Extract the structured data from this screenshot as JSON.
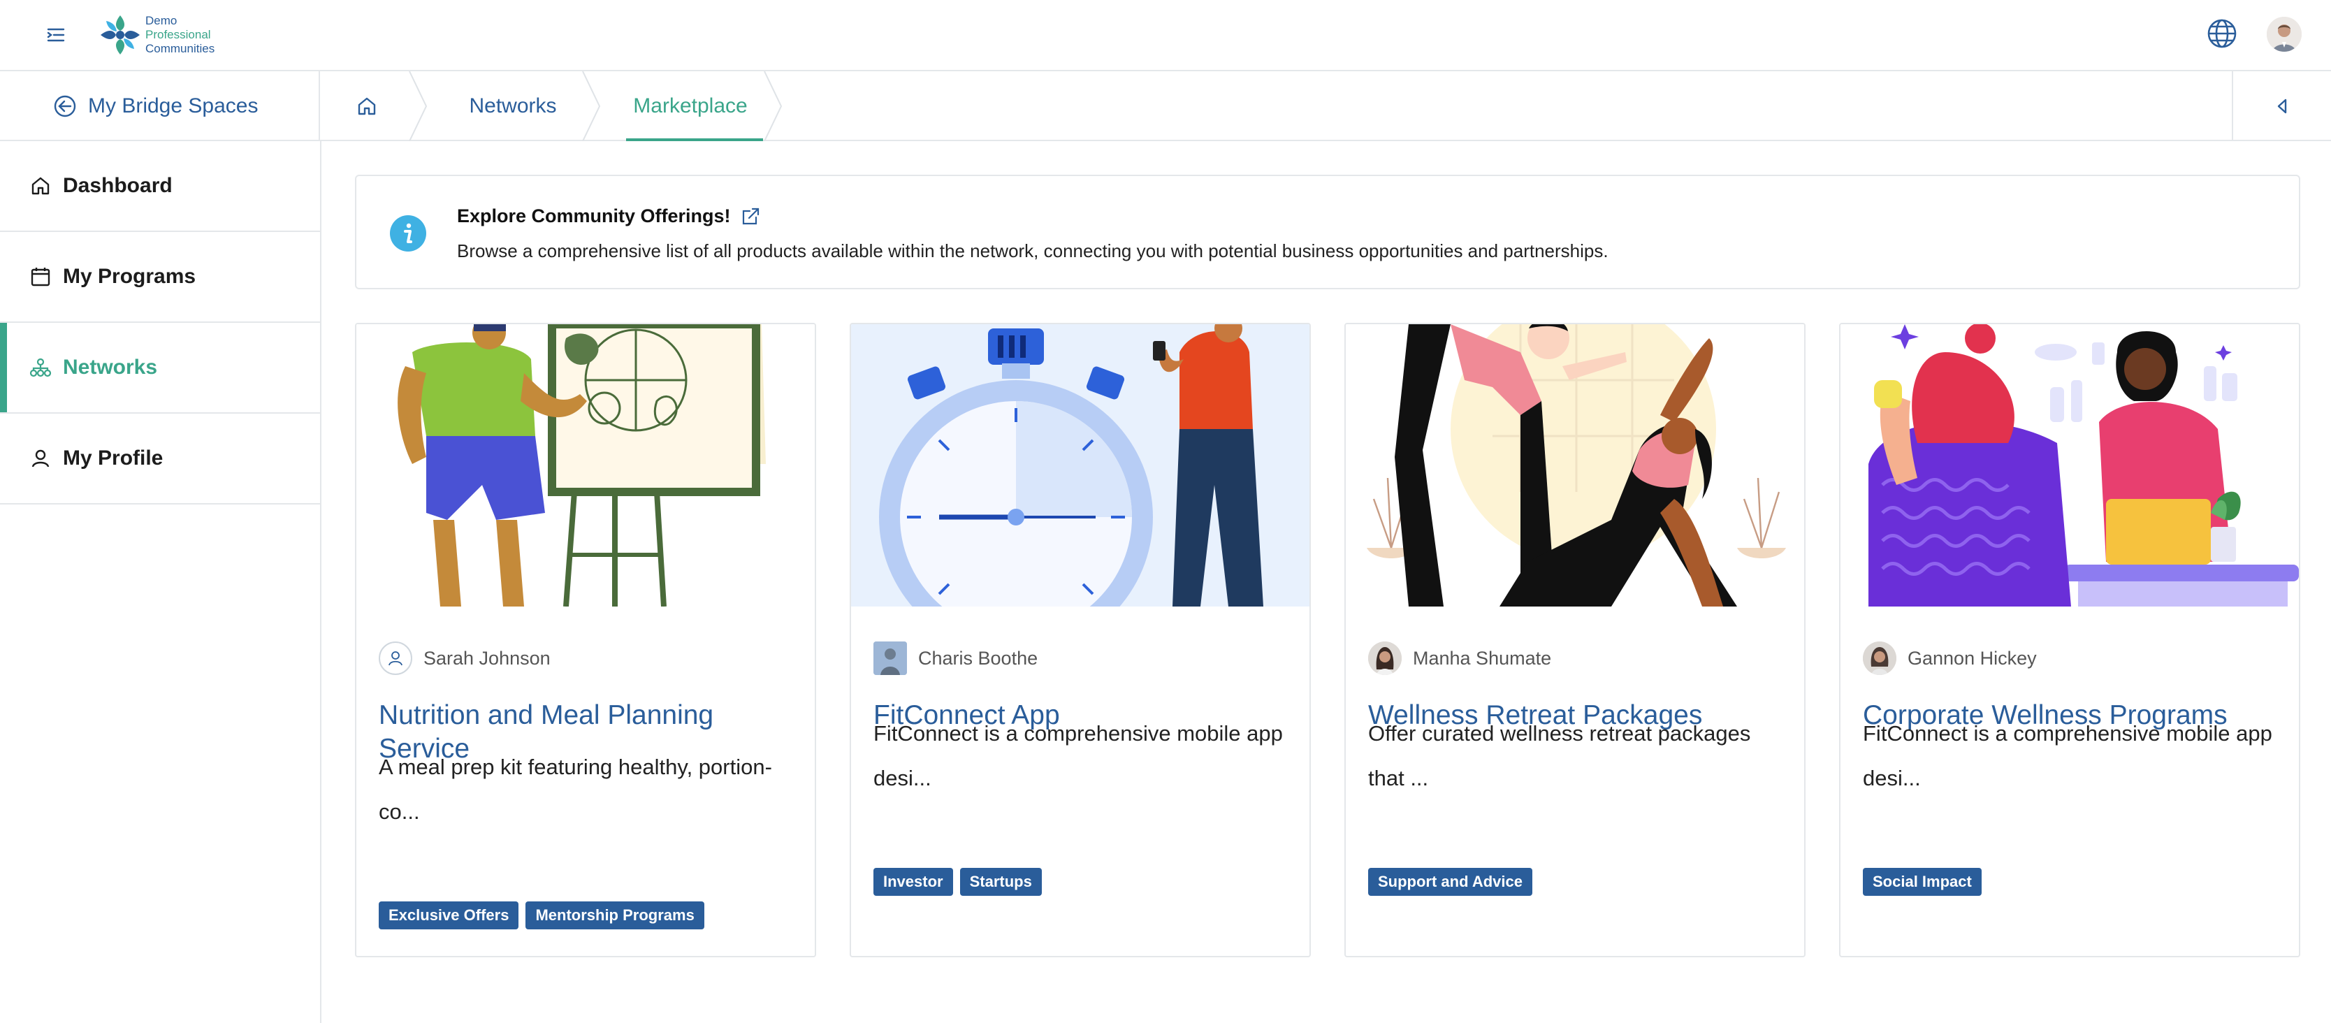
{
  "header": {
    "logo_line1": "Demo",
    "logo_line2": "Professional",
    "logo_line3": "Communities"
  },
  "subbar": {
    "back_label": "My Bridge Spaces",
    "crumb_networks": "Networks",
    "crumb_marketplace": "Marketplace"
  },
  "sidebar": {
    "items": [
      {
        "label": "Dashboard"
      },
      {
        "label": "My Programs"
      },
      {
        "label": "Networks"
      },
      {
        "label": "My Profile"
      }
    ]
  },
  "banner": {
    "title": "Explore Community Offerings!",
    "description": "Browse a comprehensive list of all products available within the network, connecting you with potential business opportunities and partnerships."
  },
  "cards": [
    {
      "author": "Sarah Johnson",
      "title": "Nutrition and Meal Planning Service",
      "description": "A meal prep kit featuring healthy, portion-co...",
      "tags": [
        "Exclusive Offers",
        "Mentorship Programs"
      ]
    },
    {
      "author": "Charis Boothe",
      "title": "FitConnect App",
      "description": "FitConnect is a comprehensive mobile app desi...",
      "tags": [
        "Investor",
        "Startups"
      ]
    },
    {
      "author": "Manha Shumate",
      "title": "Wellness Retreat Packages",
      "description": "Offer curated wellness retreat packages that ...",
      "tags": [
        "Support and Advice"
      ]
    },
    {
      "author": "Gannon Hickey",
      "title": "Corporate Wellness Programs",
      "description": "FitConnect is a comprehensive mobile app desi...",
      "tags": [
        "Social Impact"
      ]
    }
  ],
  "colors": {
    "primary_blue": "#2a5d9a",
    "accent_green": "#3aa58a",
    "info_blue": "#3fb1e3",
    "border": "#e4e7ea"
  },
  "icons": {
    "menu": "menu-toggle-icon",
    "globe": "globe-icon",
    "back": "arrow-left-circle-icon",
    "home": "home-icon",
    "collapse": "caret-left-icon",
    "dashboard": "home-icon",
    "programs": "calendar-icon",
    "networks": "network-icon",
    "profile": "user-icon",
    "info": "info-icon",
    "external": "external-link-icon"
  }
}
